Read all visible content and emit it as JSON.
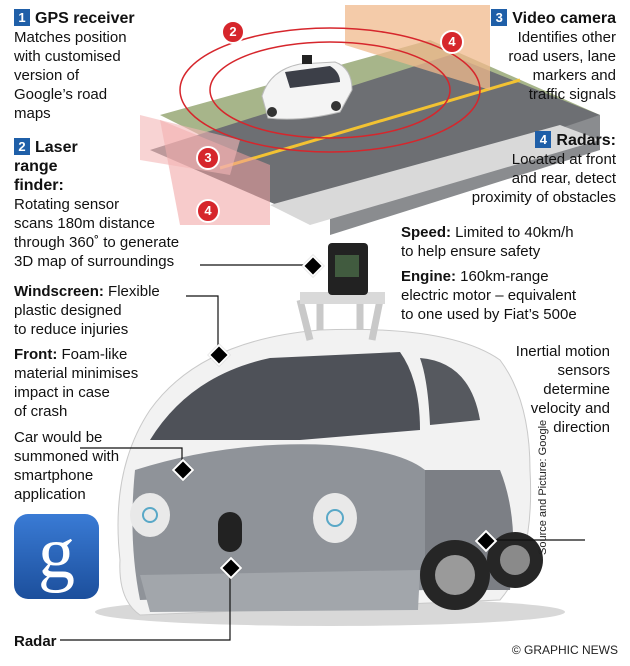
{
  "callouts": {
    "gps": {
      "number": "1",
      "title": "GPS receiver",
      "lines": [
        "Matches position",
        "with customised",
        "version of",
        "Google’s road",
        "maps"
      ]
    },
    "laser": {
      "number": "2",
      "title_lines": [
        "Laser",
        "range",
        "finder:"
      ],
      "lines": [
        "Rotating sensor",
        "scans 180m distance",
        "through 360˚ to generate",
        "3D map of surroundings"
      ]
    },
    "video": {
      "number": "3",
      "title": "Video camera",
      "lines": [
        "Identifies other",
        "road users, lane",
        "markers and",
        "traffic signals"
      ]
    },
    "radars": {
      "number": "4",
      "title": "Radars:",
      "lines": [
        "Located at front",
        "and rear, detect",
        "proximity of obstacles"
      ]
    },
    "speed": {
      "label": "Speed:",
      "lines": [
        " Limited to 40km/h",
        "to help ensure safety"
      ]
    },
    "engine": {
      "label": "Engine:",
      "lines": [
        " 160km-range",
        "electric motor – equivalent",
        "to one used by Fiat’s 500e"
      ]
    },
    "windscreen": {
      "label": "Windscreen:",
      "lines": [
        " Flexible",
        "plastic designed",
        "to reduce injuries"
      ]
    },
    "front": {
      "label": "Front:",
      "lines": [
        " Foam-like",
        "material minimises",
        "impact in case",
        "of crash"
      ]
    },
    "summon": {
      "lines": [
        "Car would be",
        "summoned with",
        "smartphone",
        "application"
      ]
    },
    "inertial": {
      "lines": [
        "Inertial motion",
        "sensors",
        "determine",
        "velocity and",
        "direction"
      ]
    },
    "radar": {
      "label": "Radar"
    }
  },
  "diagram_markers": [
    "2",
    "4",
    "3",
    "4"
  ],
  "logo_letter": "g",
  "credit": "© GRAPHIC NEWS",
  "source": "Source and Picture: Google",
  "colors": {
    "accent": "#1f5fa8",
    "marker": "#d6262c",
    "road": "#6d6f73",
    "field_green": "#9fae7c",
    "field_orange": "#f0b98c"
  }
}
